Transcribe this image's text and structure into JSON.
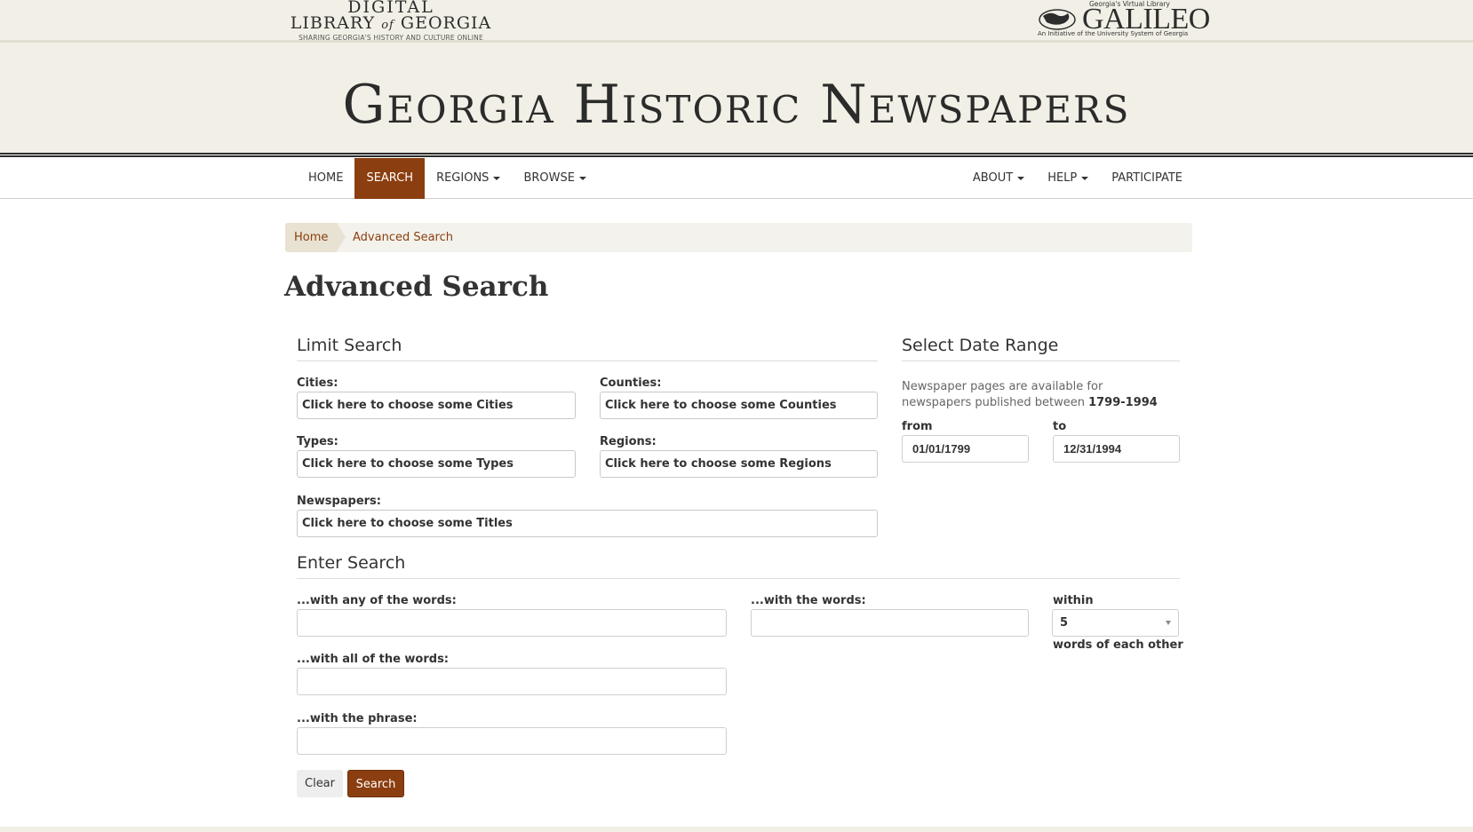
{
  "header": {
    "dlg_logo": {
      "line1": "DIGITAL",
      "line2_a": "LIBRARY",
      "line2_of": "of",
      "line2_b": "GEORGIA",
      "tagline": "SHARING GEORGIA'S HISTORY AND CULTURE ONLINE"
    },
    "galileo_logo": {
      "tag": "Georgia's Virtual Library",
      "name": "GALILEO",
      "sub": "An Initiative of the University System of Georgia"
    },
    "site_title": "Georgia Historic Newspapers"
  },
  "nav": {
    "left": [
      {
        "label": "HOME",
        "active": false,
        "dropdown": false
      },
      {
        "label": "SEARCH",
        "active": true,
        "dropdown": false
      },
      {
        "label": "REGIONS",
        "active": false,
        "dropdown": true
      },
      {
        "label": "BROWSE",
        "active": false,
        "dropdown": true
      }
    ],
    "right": [
      {
        "label": "ABOUT",
        "dropdown": true
      },
      {
        "label": "HELP",
        "dropdown": true
      },
      {
        "label": "PARTICIPATE",
        "dropdown": false
      }
    ]
  },
  "breadcrumb": {
    "home": "Home",
    "current": "Advanced Search"
  },
  "page_title": "Advanced Search",
  "limit_search": {
    "title": "Limit Search",
    "cities_label": "Cities:",
    "cities_placeholder": "Click here to choose some Cities",
    "counties_label": "Counties:",
    "counties_placeholder": "Click here to choose some Counties",
    "types_label": "Types:",
    "types_placeholder": "Click here to choose some Types",
    "regions_label": "Regions:",
    "regions_placeholder": "Click here to choose some Regions",
    "newspapers_label": "Newspapers:",
    "newspapers_placeholder": "Click here to choose some Titles"
  },
  "date_range": {
    "title": "Select Date Range",
    "help_prefix": "Newspaper pages are available for newspapers published between",
    "help_range": "1799-1994",
    "from_label": "from",
    "from_value": "01/01/1799",
    "to_label": "to",
    "to_value": "12/31/1994"
  },
  "enter_search": {
    "title": "Enter Search",
    "any_words_label": "...with any of the words:",
    "any_words_value": "",
    "with_words_label": "...with the words:",
    "with_words_value": "",
    "within_label": "within",
    "within_value": "5",
    "within_suffix": "words of each other",
    "all_words_label": "...with all of the words:",
    "all_words_value": "",
    "phrase_label": "...with the phrase:",
    "phrase_value": ""
  },
  "buttons": {
    "clear": "Clear",
    "search": "Search"
  },
  "colors": {
    "accent": "#8b3e0f",
    "banner_bg": "#f2f0e6"
  }
}
